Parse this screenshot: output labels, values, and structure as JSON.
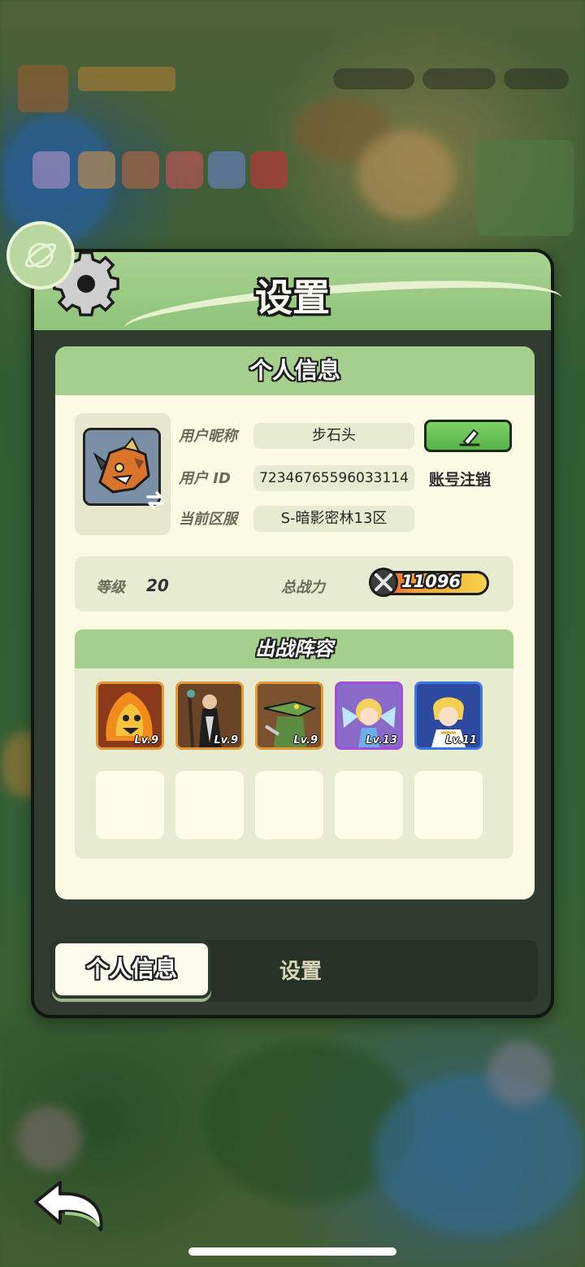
{
  "window": {
    "title": "设置"
  },
  "profile": {
    "section_title": "个人信息",
    "nickname_label": "用户昵称",
    "nickname_value": "步石头",
    "userid_label": "用户 ID",
    "userid_value": "72346765596033114",
    "account_cancel_label": "账号注销",
    "server_label": "当前区服",
    "server_value": "S-暗影密林13区"
  },
  "stats": {
    "level_label": "等级",
    "level_value": "20",
    "power_label": "总战力",
    "power_value": "11096"
  },
  "lineup": {
    "title": "出战阵容",
    "heroes": [
      {
        "level": "Lv.9",
        "rarity": "orange",
        "icon": "fire-beast-hero"
      },
      {
        "level": "Lv.9",
        "rarity": "orange",
        "icon": "robed-sorcerer-hero"
      },
      {
        "level": "Lv.9",
        "rarity": "orange",
        "icon": "crocodile-warrior-hero"
      },
      {
        "level": "Lv.13",
        "rarity": "purple",
        "icon": "fairy-girl-hero"
      },
      {
        "level": "Lv.11",
        "rarity": "blue",
        "icon": "blonde-knight-hero"
      }
    ],
    "empty_slots": 5
  },
  "tabs": {
    "active": "个人信息",
    "inactive": "设置"
  },
  "colors": {
    "header_green": "#a4cf8d",
    "panel_cream": "#fbfbe4",
    "edit_green": "#6cc456"
  }
}
